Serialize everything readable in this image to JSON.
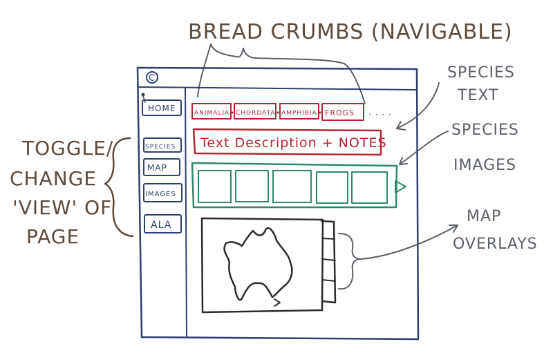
{
  "annotations": {
    "breadcrumbs": "BREAD CRUMBS (NAVIGABLE)",
    "species_text": [
      "SPECIES",
      "TEXT"
    ],
    "species_images": [
      "SPECIES",
      "IMAGES"
    ],
    "map_overlays": [
      "MAP",
      "OVERLAYS"
    ],
    "toggle_view": [
      "TOGGLE/",
      "CHANGE",
      "'VIEW' OF",
      "PAGE"
    ]
  },
  "window": {
    "logo": "C"
  },
  "sidebar": {
    "items": [
      {
        "label": "HOME"
      },
      {
        "label": "SPECIES"
      },
      {
        "label": "MAP"
      },
      {
        "label": "IMAGES"
      },
      {
        "label": "ALA"
      }
    ]
  },
  "breadcrumb": {
    "items": [
      "ANIMALIA",
      "CHORDATA",
      "AMPHIBIA",
      "FROGS"
    ],
    "ellipsis": "· · · ·"
  },
  "species": {
    "text_description": "Text Description + NOTES"
  },
  "colors": {
    "window_ink": "#2e3f6e",
    "breadcrumb_ink": "#b32636",
    "images_ink": "#2c8a68",
    "annotation_ink": "#5e4a3a",
    "map_ink": "#2b2b2b"
  }
}
